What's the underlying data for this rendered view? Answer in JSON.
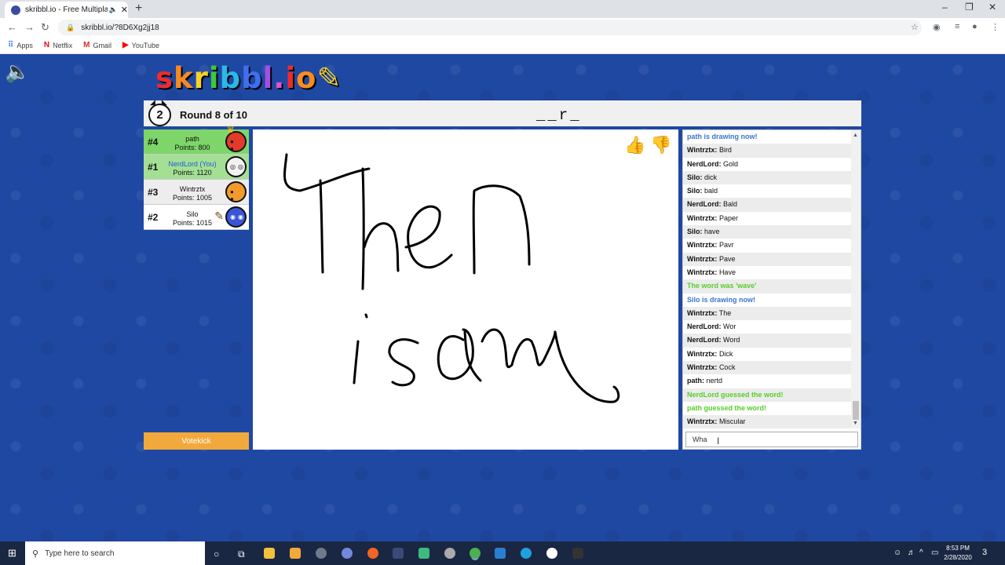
{
  "browser": {
    "tab_title": "skribbl.io - Free Multiplayer D",
    "url": "skribbl.io/?8D6Xg2jj18",
    "bookmarks": [
      "Apps",
      "Netflix",
      "Gmail",
      "YouTube"
    ]
  },
  "game": {
    "logo": "skribbl.io",
    "timer": "2",
    "round": "Round 8 of 10",
    "word_hint": "__r_",
    "votekick_label": "Votekick"
  },
  "players": [
    {
      "rank": "#4",
      "name": "path",
      "points": "Points: 800",
      "you": false,
      "color": "#e23b2a"
    },
    {
      "rank": "#1",
      "name": "NerdLord (You)",
      "points": "Points: 1120",
      "you": true,
      "color": "#f2f2f2"
    },
    {
      "rank": "#3",
      "name": "Wintrztx",
      "points": "Points: 1005",
      "you": false,
      "color": "#f29b2b"
    },
    {
      "rank": "#2",
      "name": "Silo",
      "points": "Points: 1015",
      "you": false,
      "color": "#3a55d6"
    }
  ],
  "chat": {
    "messages": [
      {
        "who": "",
        "text": "path is drawing now!",
        "style": "blue"
      },
      {
        "who": "Wintrztx:",
        "text": "Bird",
        "style": ""
      },
      {
        "who": "NerdLord:",
        "text": "Gold",
        "style": ""
      },
      {
        "who": "Silo:",
        "text": "dick",
        "style": ""
      },
      {
        "who": "Silo:",
        "text": "bald",
        "style": ""
      },
      {
        "who": "NerdLord:",
        "text": "Bald",
        "style": ""
      },
      {
        "who": "Wintrztx:",
        "text": "Paper",
        "style": ""
      },
      {
        "who": "Silo:",
        "text": "have",
        "style": ""
      },
      {
        "who": "Wintrztx:",
        "text": "Pavr",
        "style": ""
      },
      {
        "who": "Wintrztx:",
        "text": "Pave",
        "style": ""
      },
      {
        "who": "Wintrztx:",
        "text": "Have",
        "style": ""
      },
      {
        "who": "",
        "text": "The word was 'wave'",
        "style": "green"
      },
      {
        "who": "",
        "text": "Silo is drawing now!",
        "style": "blue"
      },
      {
        "who": "Wintrztx:",
        "text": "The",
        "style": ""
      },
      {
        "who": "NerdLord:",
        "text": "Wor",
        "style": ""
      },
      {
        "who": "NerdLord:",
        "text": "Word",
        "style": ""
      },
      {
        "who": "Wintrztx:",
        "text": "Dick",
        "style": ""
      },
      {
        "who": "Wintrztx:",
        "text": "Cock",
        "style": ""
      },
      {
        "who": "path:",
        "text": "nertd",
        "style": ""
      },
      {
        "who": "",
        "text": "NerdLord guessed the word!",
        "style": "green"
      },
      {
        "who": "",
        "text": "path guessed the word!",
        "style": "green"
      },
      {
        "who": "Wintrztx:",
        "text": "Miscular",
        "style": ""
      }
    ],
    "input_value": "Wha"
  },
  "taskbar": {
    "search_placeholder": "Type here to search",
    "time": "8:53 PM",
    "date": "2/28/2020",
    "notifications": "3"
  }
}
